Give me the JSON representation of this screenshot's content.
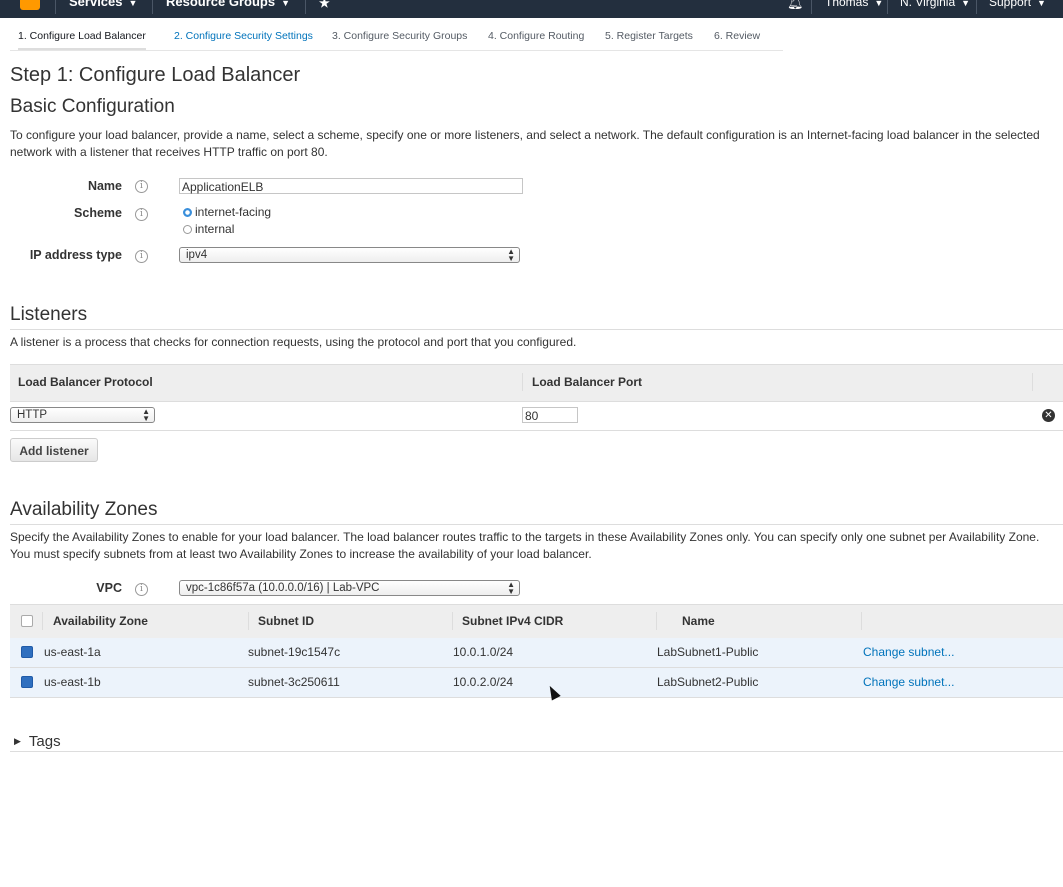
{
  "topnav": {
    "services": "Services",
    "resource_groups": "Resource Groups",
    "user": "Thomas",
    "region": "N. Virginia",
    "support": "Support"
  },
  "wizard_tabs": [
    "1. Configure Load Balancer",
    "2. Configure Security Settings",
    "3. Configure Security Groups",
    "4. Configure Routing",
    "5. Register Targets",
    "6. Review"
  ],
  "page_title": "Step 1: Configure Load Balancer",
  "basic": {
    "heading": "Basic Configuration",
    "description": "To configure your load balancer, provide a name, select a scheme, specify one or more listeners, and select a network. The default configuration is an Internet-facing load balancer in the selected network with a listener that receives HTTP traffic on port 80.",
    "name_label": "Name",
    "name_value": "ApplicationELB",
    "scheme_label": "Scheme",
    "scheme_options": [
      "internet-facing",
      "internal"
    ],
    "ip_label": "IP address type",
    "ip_value": "ipv4"
  },
  "listeners": {
    "heading": "Listeners",
    "description": "A listener is a process that checks for connection requests, using the protocol and port that you configured.",
    "col_protocol": "Load Balancer Protocol",
    "col_port": "Load Balancer Port",
    "protocol_value": "HTTP",
    "port_value": "80",
    "add_button": "Add listener"
  },
  "az": {
    "heading": "Availability Zones",
    "description": "Specify the Availability Zones to enable for your load balancer. The load balancer routes traffic to the targets in these Availability Zones only. You can specify only one subnet per Availability Zone. You must specify subnets from at least two Availability Zones to increase the availability of your load balancer.",
    "vpc_label": "VPC",
    "vpc_value": "vpc-1c86f57a (10.0.0.0/16) | Lab-VPC",
    "columns": [
      "Availability Zone",
      "Subnet ID",
      "Subnet IPv4 CIDR",
      "Name"
    ],
    "rows": [
      {
        "zone": "us-east-1a",
        "subnet": "subnet-19c1547c",
        "cidr": "10.0.1.0/24",
        "name": "LabSubnet1-Public",
        "action": "Change subnet..."
      },
      {
        "zone": "us-east-1b",
        "subnet": "subnet-3c250611",
        "cidr": "10.0.2.0/24",
        "name": "LabSubnet2-Public",
        "action": "Change subnet..."
      }
    ]
  },
  "tags": {
    "label": "Tags"
  },
  "colors": {
    "topbar": "#232f3e",
    "link": "#0073bb",
    "accent": "#ff9900"
  }
}
